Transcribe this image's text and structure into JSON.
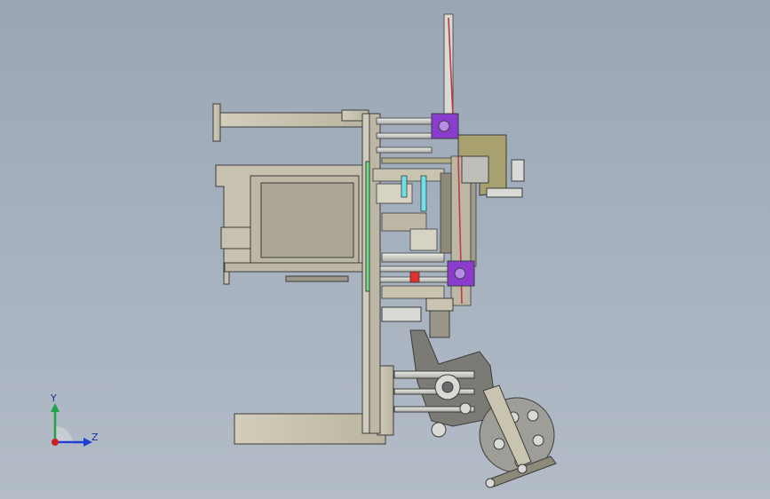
{
  "viewport": {
    "colors": {
      "background_top": "#9aa6b5",
      "background_bottom": "#b3bcc7"
    }
  },
  "model": {
    "colors": {
      "frame": "#c9c4b0",
      "frame_dark": "#8e8a7a",
      "edge": "#3c3c3c",
      "motor": "#8a3ccf",
      "belt": "#c23a3a",
      "accent_green": "#6fe08a",
      "accent_cyan": "#6fe0e6",
      "accent_red": "#e03030",
      "steel": "#d9d9d6",
      "olive": "#a8a06e"
    }
  },
  "triad": {
    "y_label": "Y",
    "z_label": "Z",
    "colors": {
      "y_axis": "#1fa34a",
      "z_axis": "#1f3fd0",
      "origin": "#cc2020"
    }
  }
}
